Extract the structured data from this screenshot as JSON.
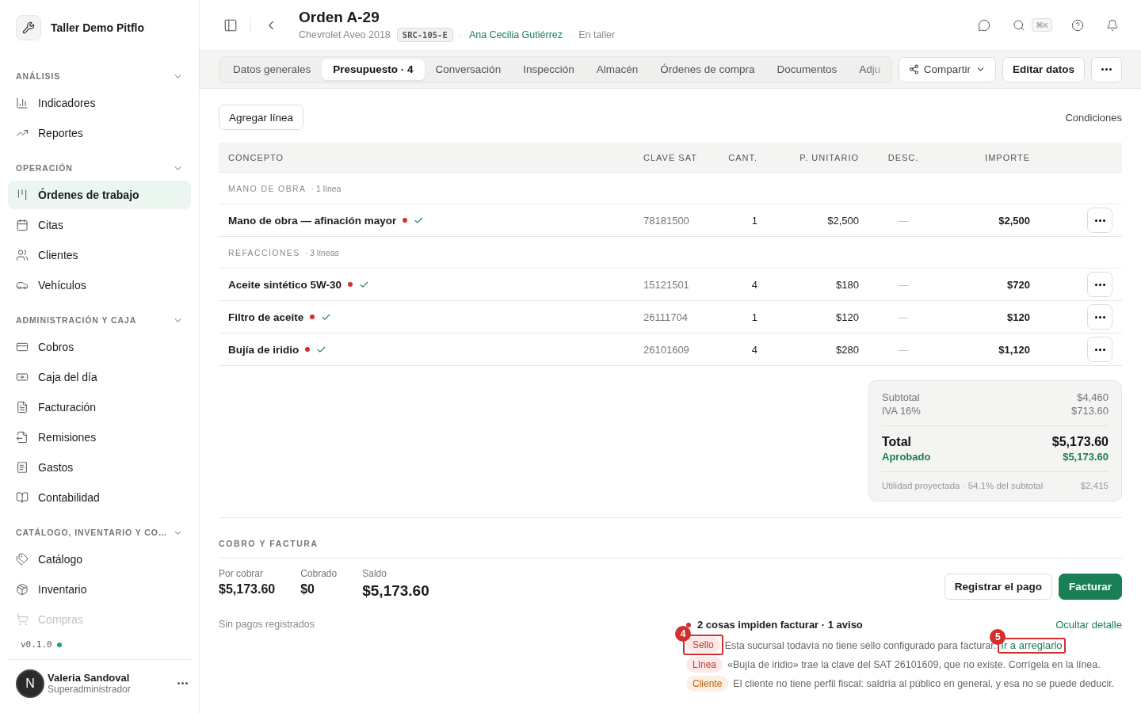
{
  "sidebar": {
    "workspace": "Taller Demo Pitflo",
    "sections": [
      {
        "title": "ANÁLISIS",
        "expanded": true,
        "items": [
          {
            "label": "Indicadores",
            "selected": false,
            "faded": false
          },
          {
            "label": "Reportes",
            "selected": false,
            "faded": false
          }
        ]
      },
      {
        "title": "OPERACIÓN",
        "expanded": true,
        "items": [
          {
            "label": "Órdenes de trabajo",
            "selected": true,
            "faded": false
          },
          {
            "label": "Citas",
            "selected": false,
            "faded": false
          },
          {
            "label": "Clientes",
            "selected": false,
            "faded": false
          },
          {
            "label": "Vehículos",
            "selected": false,
            "faded": false
          }
        ]
      },
      {
        "title": "ADMINISTRACIÓN Y CAJA",
        "expanded": true,
        "items": [
          {
            "label": "Cobros",
            "selected": false,
            "faded": false
          },
          {
            "label": "Caja del día",
            "selected": false,
            "faded": false
          },
          {
            "label": "Facturación",
            "selected": false,
            "faded": false
          },
          {
            "label": "Remisiones",
            "selected": false,
            "faded": false
          },
          {
            "label": "Gastos",
            "selected": false,
            "faded": false
          },
          {
            "label": "Contabilidad",
            "selected": false,
            "faded": false
          }
        ]
      },
      {
        "title": "CATÁLOGO, INVENTARIO Y CO…",
        "expanded": true,
        "items": [
          {
            "label": "Catálogo",
            "selected": false,
            "faded": false
          },
          {
            "label": "Inventario",
            "selected": false,
            "faded": false
          },
          {
            "label": "Compras",
            "selected": false,
            "faded": true
          }
        ]
      }
    ],
    "version": "v0.1.0",
    "online": true,
    "user": {
      "initial": "N",
      "name": "Valeria Sandoval",
      "role": "Superadministrador"
    }
  },
  "header": {
    "title": "Orden A-29",
    "vehicle": "Chevrolet Aveo 2018",
    "plate": "SRC-105-E",
    "separators": [
      "·",
      "·"
    ],
    "customer": "Ana Cecilia Gutiérrez",
    "status": "En taller",
    "shortcut": "⌘K"
  },
  "tabs": [
    {
      "label": "Datos generales",
      "selected": false
    },
    {
      "label": "Presupuesto · 4",
      "selected": true
    },
    {
      "label": "Conversación",
      "selected": false
    },
    {
      "label": "Inspección",
      "selected": false
    },
    {
      "label": "Almacén",
      "selected": false
    },
    {
      "label": "Órdenes de compra",
      "selected": false
    },
    {
      "label": "Documentos",
      "selected": false
    },
    {
      "label": "Adju",
      "selected": false
    }
  ],
  "actions": {
    "share": "Compartir",
    "edit": "Editar datos"
  },
  "budget": {
    "add_button": "Agregar línea",
    "conditions": "Condiciones",
    "columns": [
      "CONCEPTO",
      "CLAVE SAT",
      "CANT.",
      "P. UNITARIO",
      "DESC.",
      "IMPORTE"
    ],
    "groups": [
      {
        "title": "MANO DE OBRA",
        "count": "· 1 línea",
        "rows": [
          {
            "concept": "Mano de obra — afinación mayor",
            "flagged": true,
            "verified": true,
            "code": "78181500",
            "qty": "1",
            "unit": "$2,500",
            "discount": "—",
            "amount": "$2,500"
          }
        ]
      },
      {
        "title": "REFACCIONES",
        "count": "· 3 líneas",
        "rows": [
          {
            "concept": "Aceite sintético 5W-30",
            "flagged": true,
            "verified": true,
            "code": "15121501",
            "qty": "4",
            "unit": "$180",
            "discount": "—",
            "amount": "$720"
          },
          {
            "concept": "Filtro de aceite",
            "flagged": true,
            "verified": true,
            "code": "26111704",
            "qty": "1",
            "unit": "$120",
            "discount": "—",
            "amount": "$120"
          },
          {
            "concept": "Bujía de iridio",
            "flagged": true,
            "verified": true,
            "code": "26101609",
            "qty": "4",
            "unit": "$280",
            "discount": "—",
            "amount": "$1,120"
          }
        ]
      }
    ]
  },
  "totals": {
    "subtotal_label": "Subtotal",
    "subtotal": "$4,460",
    "tax_label": "IVA 16%",
    "tax": "$713.60",
    "total_label": "Total",
    "total": "$5,173.60",
    "approved_label": "Aprobado",
    "approved": "$5,173.60",
    "profit_label": "Utilidad proyectada · 54.1% del subtotal",
    "profit": "$2,415"
  },
  "billing": {
    "title": "COBRO Y FACTURA",
    "stats": [
      {
        "label": "Por cobrar",
        "value": "$5,173.60",
        "emphasis": false
      },
      {
        "label": "Cobrado",
        "value": "$0",
        "emphasis": false
      },
      {
        "label": "Saldo",
        "value": "$5,173.60",
        "emphasis": true
      }
    ],
    "note": "Sin pagos registrados",
    "register_button": "Registrar el pago",
    "invoice_button": "Facturar",
    "summary": "2 cosas impiden facturar · 1 aviso",
    "toggle": "Ocultar detalle",
    "issues": [
      {
        "tag": "Sello",
        "kind": "error",
        "text": "Esta sucursal todavía no tiene sello configurado para facturar.",
        "link": "Ir a arreglarlo",
        "tag_callout": "4",
        "link_callout": "5"
      },
      {
        "tag": "Línea",
        "kind": "error",
        "text": "«Bujía de iridio» trae la clave del SAT 26101609, que no existe. Corrígela en la línea."
      },
      {
        "tag": "Cliente",
        "kind": "warning",
        "text": "El cliente no tiene perfil fiscal: saldría al público en general, y esa no se puede deducir."
      }
    ]
  }
}
